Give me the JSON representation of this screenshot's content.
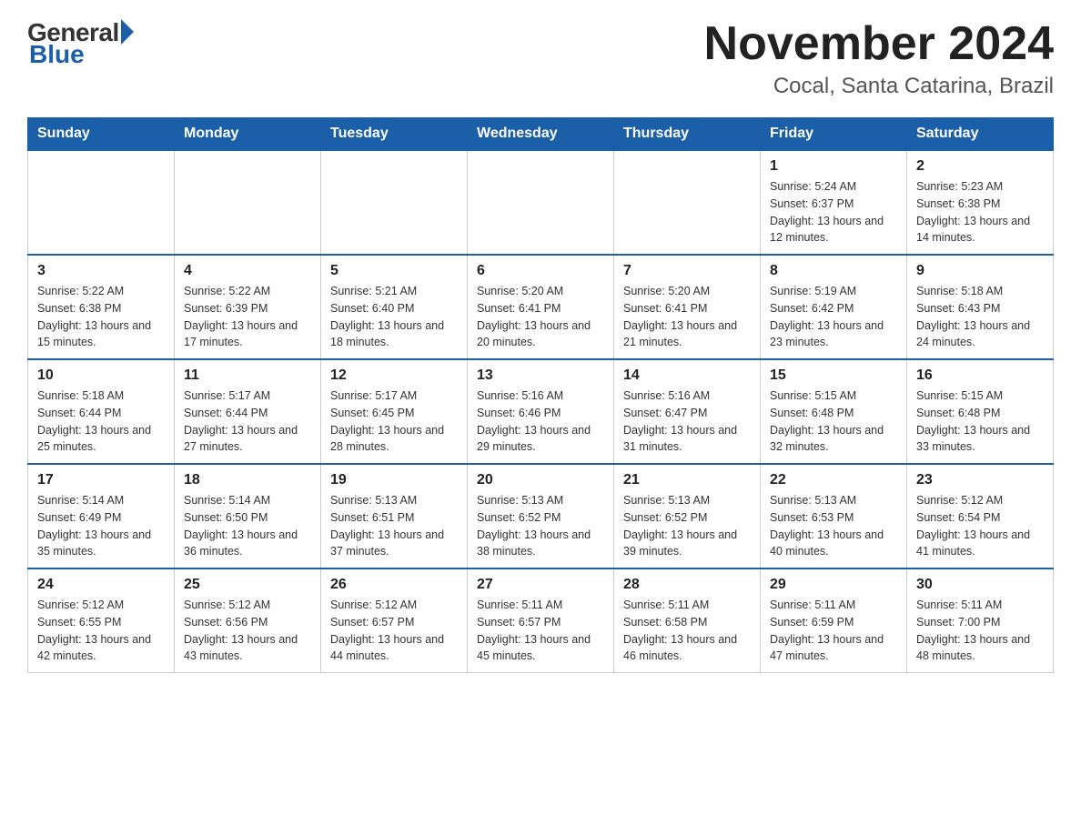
{
  "logo": {
    "general": "General",
    "blue": "Blue"
  },
  "title": "November 2024",
  "subtitle": "Cocal, Santa Catarina, Brazil",
  "days_of_week": [
    "Sunday",
    "Monday",
    "Tuesday",
    "Wednesday",
    "Thursday",
    "Friday",
    "Saturday"
  ],
  "weeks": [
    [
      {
        "day": "",
        "info": ""
      },
      {
        "day": "",
        "info": ""
      },
      {
        "day": "",
        "info": ""
      },
      {
        "day": "",
        "info": ""
      },
      {
        "day": "",
        "info": ""
      },
      {
        "day": "1",
        "info": "Sunrise: 5:24 AM\nSunset: 6:37 PM\nDaylight: 13 hours and 12 minutes."
      },
      {
        "day": "2",
        "info": "Sunrise: 5:23 AM\nSunset: 6:38 PM\nDaylight: 13 hours and 14 minutes."
      }
    ],
    [
      {
        "day": "3",
        "info": "Sunrise: 5:22 AM\nSunset: 6:38 PM\nDaylight: 13 hours and 15 minutes."
      },
      {
        "day": "4",
        "info": "Sunrise: 5:22 AM\nSunset: 6:39 PM\nDaylight: 13 hours and 17 minutes."
      },
      {
        "day": "5",
        "info": "Sunrise: 5:21 AM\nSunset: 6:40 PM\nDaylight: 13 hours and 18 minutes."
      },
      {
        "day": "6",
        "info": "Sunrise: 5:20 AM\nSunset: 6:41 PM\nDaylight: 13 hours and 20 minutes."
      },
      {
        "day": "7",
        "info": "Sunrise: 5:20 AM\nSunset: 6:41 PM\nDaylight: 13 hours and 21 minutes."
      },
      {
        "day": "8",
        "info": "Sunrise: 5:19 AM\nSunset: 6:42 PM\nDaylight: 13 hours and 23 minutes."
      },
      {
        "day": "9",
        "info": "Sunrise: 5:18 AM\nSunset: 6:43 PM\nDaylight: 13 hours and 24 minutes."
      }
    ],
    [
      {
        "day": "10",
        "info": "Sunrise: 5:18 AM\nSunset: 6:44 PM\nDaylight: 13 hours and 25 minutes."
      },
      {
        "day": "11",
        "info": "Sunrise: 5:17 AM\nSunset: 6:44 PM\nDaylight: 13 hours and 27 minutes."
      },
      {
        "day": "12",
        "info": "Sunrise: 5:17 AM\nSunset: 6:45 PM\nDaylight: 13 hours and 28 minutes."
      },
      {
        "day": "13",
        "info": "Sunrise: 5:16 AM\nSunset: 6:46 PM\nDaylight: 13 hours and 29 minutes."
      },
      {
        "day": "14",
        "info": "Sunrise: 5:16 AM\nSunset: 6:47 PM\nDaylight: 13 hours and 31 minutes."
      },
      {
        "day": "15",
        "info": "Sunrise: 5:15 AM\nSunset: 6:48 PM\nDaylight: 13 hours and 32 minutes."
      },
      {
        "day": "16",
        "info": "Sunrise: 5:15 AM\nSunset: 6:48 PM\nDaylight: 13 hours and 33 minutes."
      }
    ],
    [
      {
        "day": "17",
        "info": "Sunrise: 5:14 AM\nSunset: 6:49 PM\nDaylight: 13 hours and 35 minutes."
      },
      {
        "day": "18",
        "info": "Sunrise: 5:14 AM\nSunset: 6:50 PM\nDaylight: 13 hours and 36 minutes."
      },
      {
        "day": "19",
        "info": "Sunrise: 5:13 AM\nSunset: 6:51 PM\nDaylight: 13 hours and 37 minutes."
      },
      {
        "day": "20",
        "info": "Sunrise: 5:13 AM\nSunset: 6:52 PM\nDaylight: 13 hours and 38 minutes."
      },
      {
        "day": "21",
        "info": "Sunrise: 5:13 AM\nSunset: 6:52 PM\nDaylight: 13 hours and 39 minutes."
      },
      {
        "day": "22",
        "info": "Sunrise: 5:13 AM\nSunset: 6:53 PM\nDaylight: 13 hours and 40 minutes."
      },
      {
        "day": "23",
        "info": "Sunrise: 5:12 AM\nSunset: 6:54 PM\nDaylight: 13 hours and 41 minutes."
      }
    ],
    [
      {
        "day": "24",
        "info": "Sunrise: 5:12 AM\nSunset: 6:55 PM\nDaylight: 13 hours and 42 minutes."
      },
      {
        "day": "25",
        "info": "Sunrise: 5:12 AM\nSunset: 6:56 PM\nDaylight: 13 hours and 43 minutes."
      },
      {
        "day": "26",
        "info": "Sunrise: 5:12 AM\nSunset: 6:57 PM\nDaylight: 13 hours and 44 minutes."
      },
      {
        "day": "27",
        "info": "Sunrise: 5:11 AM\nSunset: 6:57 PM\nDaylight: 13 hours and 45 minutes."
      },
      {
        "day": "28",
        "info": "Sunrise: 5:11 AM\nSunset: 6:58 PM\nDaylight: 13 hours and 46 minutes."
      },
      {
        "day": "29",
        "info": "Sunrise: 5:11 AM\nSunset: 6:59 PM\nDaylight: 13 hours and 47 minutes."
      },
      {
        "day": "30",
        "info": "Sunrise: 5:11 AM\nSunset: 7:00 PM\nDaylight: 13 hours and 48 minutes."
      }
    ]
  ]
}
